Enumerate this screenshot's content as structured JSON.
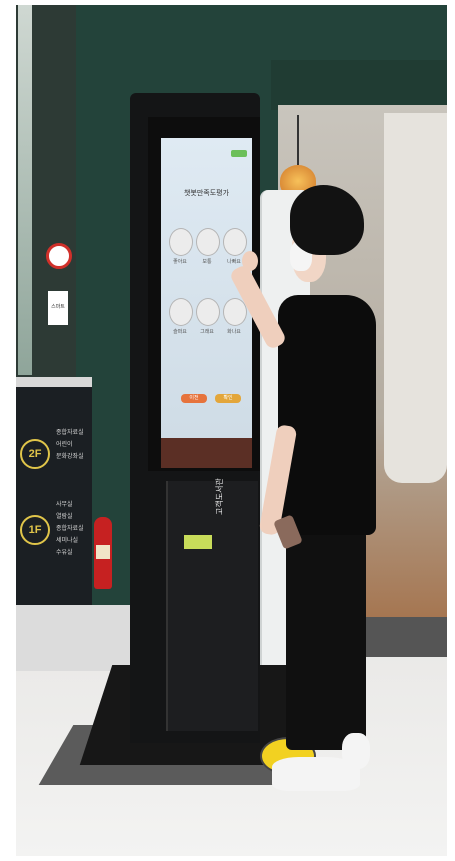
{
  "image": {
    "kind": "photo",
    "accent_colors": {
      "wall": "#23433a",
      "kiosk": "#141516",
      "screen": "#dfeaf3",
      "sticker": "#f2d121"
    }
  },
  "kiosk": {
    "screen_title": "챗봇만족도평가",
    "faces": [
      {
        "icon": "smiling-face-icon",
        "label": "좋아요"
      },
      {
        "icon": "neutral-face-icon",
        "label": "보통"
      },
      {
        "icon": "frowning-face-icon",
        "label": "나빠요"
      },
      {
        "icon": "sad-face-icon",
        "label": "슬퍼요"
      },
      {
        "icon": "calm-face-icon",
        "label": "그래요"
      },
      {
        "icon": "angry-face-icon",
        "label": "화나요"
      }
    ],
    "buttons": [
      {
        "label": "이전",
        "color": "#e6733c"
      },
      {
        "label": "확인",
        "color": "#e3a63a"
      }
    ],
    "logo_text": "고객도서관"
  },
  "signage": {
    "floors": [
      {
        "badge": "2F",
        "lines": [
          "종합자료실",
          "어린이",
          "문화강좌실"
        ]
      },
      {
        "badge": "1F",
        "lines": [
          "사무실",
          "열람실",
          "종합자료실",
          "세미나실",
          "수유실"
        ]
      }
    ],
    "small_sign": "스마트"
  }
}
